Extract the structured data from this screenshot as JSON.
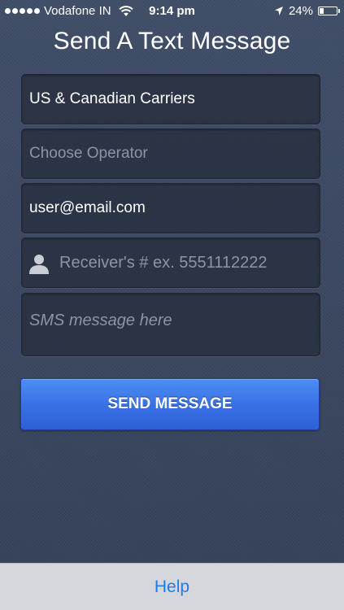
{
  "status_bar": {
    "carrier": "Vodafone IN",
    "time": "9:14 pm",
    "battery": "24%",
    "battery_level": 0.24,
    "signal_bars": 5
  },
  "page": {
    "title": "Send A Text Message"
  },
  "form": {
    "carrier_value": "US & Canadian Carriers",
    "operator_placeholder": "Choose Operator",
    "email_value": "user@email.com",
    "receiver_placeholder": "Receiver's # ex. 5551112222",
    "message_placeholder": "SMS message here"
  },
  "actions": {
    "send_label": "SEND MESSAGE"
  },
  "bottom_bar": {
    "help_label": "Help"
  },
  "colors": {
    "background": "#3d4a63",
    "accent": "#3a72e6",
    "link": "#1a7cf0"
  }
}
